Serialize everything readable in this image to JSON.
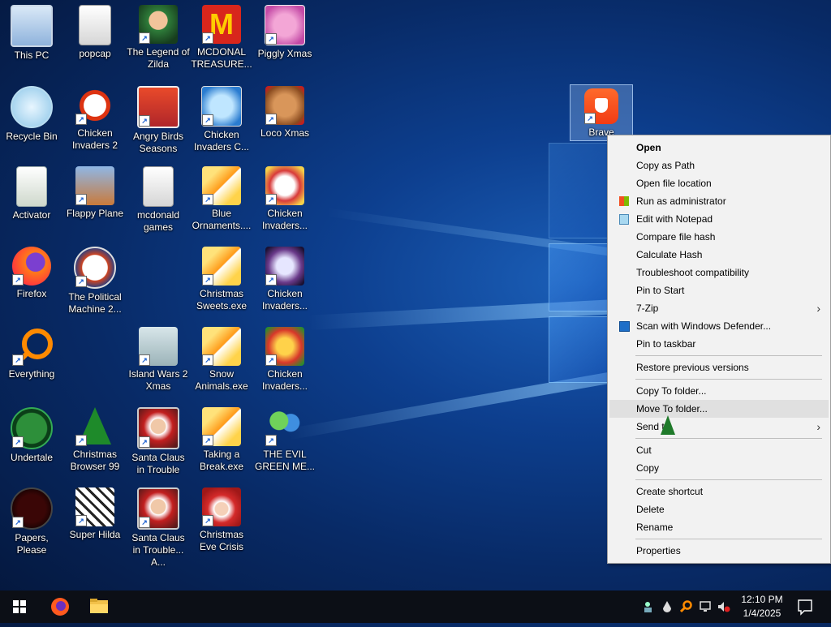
{
  "desktop_icons": [
    {
      "label": "This PC",
      "icon": "computer-icon"
    },
    {
      "label": "popcap",
      "icon": "folder-icon"
    },
    {
      "label": "The Legend of Zilda",
      "icon": "game-icon"
    },
    {
      "label": "MCDONAL TREASURE...",
      "icon": "mcdonalds-icon"
    },
    {
      "label": "Piggly Xmas",
      "icon": "pig-icon"
    },
    {
      "label": "Recycle Bin",
      "icon": "recycle-bin-icon"
    },
    {
      "label": "Chicken Invaders 2",
      "icon": "chicken-icon"
    },
    {
      "label": "Angry Birds Seasons",
      "icon": "angry-birds-icon"
    },
    {
      "label": "Chicken Invaders C...",
      "icon": "chicken-icon"
    },
    {
      "label": "Loco Xmas",
      "icon": "bear-icon"
    },
    {
      "label": "Activator",
      "icon": "file-icon"
    },
    {
      "label": "Flappy Plane",
      "icon": "game-icon"
    },
    {
      "label": "mcdonald games",
      "icon": "file-icon"
    },
    {
      "label": "Blue Ornaments....",
      "icon": "puzzle-icon"
    },
    {
      "label": "Chicken Invaders...",
      "icon": "chicken-icon"
    },
    {
      "label": "Firefox",
      "icon": "firefox-icon"
    },
    {
      "label": "The Political Machine 2...",
      "icon": "political-icon"
    },
    {
      "label": "Christmas Sweets.exe",
      "icon": "puzzle-icon"
    },
    {
      "label": "Chicken Invaders...",
      "icon": "chicken-icon"
    },
    {
      "label": "Everything",
      "icon": "search-icon"
    },
    {
      "label": "Island Wars 2 Xmas",
      "icon": "game-icon"
    },
    {
      "label": "Snow Animals.exe",
      "icon": "puzzle-icon"
    },
    {
      "label": "Chicken Invaders...",
      "icon": "chicken-icon"
    },
    {
      "label": "Undertale",
      "icon": "undertale-icon"
    },
    {
      "label": "Christmas Browser 99",
      "icon": "tree-icon"
    },
    {
      "label": "Santa Claus in Trouble",
      "icon": "santa-icon"
    },
    {
      "label": "Taking a Break.exe",
      "icon": "puzzle-icon"
    },
    {
      "label": "THE EVIL GREEN ME...",
      "icon": "messenger-icon"
    },
    {
      "label": "Papers, Please",
      "icon": "papers-icon"
    },
    {
      "label": "Super Hilda",
      "icon": "game-icon"
    },
    {
      "label": "Santa Claus in Trouble... A...",
      "icon": "santa-icon"
    },
    {
      "label": "Christmas Eve Crisis",
      "icon": "santa-icon"
    },
    {
      "label": "Brave",
      "icon": "brave-icon"
    }
  ],
  "context_menu": {
    "open": "Open",
    "copy_as_path": "Copy as Path",
    "open_file_location": "Open file location",
    "run_as_admin": "Run as administrator",
    "edit_notepad": "Edit with Notepad",
    "compare_hash": "Compare file hash",
    "calc_hash": "Calculate Hash",
    "troubleshoot": "Troubleshoot compatibility",
    "pin_start": "Pin to Start",
    "zip": "7-Zip",
    "scan_defender": "Scan with Windows Defender...",
    "pin_taskbar": "Pin to taskbar",
    "restore_versions": "Restore previous versions",
    "copy_to_folder": "Copy To folder...",
    "move_to_folder": "Move To folder...",
    "send_to": "Send to",
    "cut": "Cut",
    "copy": "Copy",
    "create_shortcut": "Create shortcut",
    "delete": "Delete",
    "rename": "Rename",
    "properties": "Properties"
  },
  "taskbar": {
    "time": "12:10 PM",
    "date": "1/4/2025"
  }
}
